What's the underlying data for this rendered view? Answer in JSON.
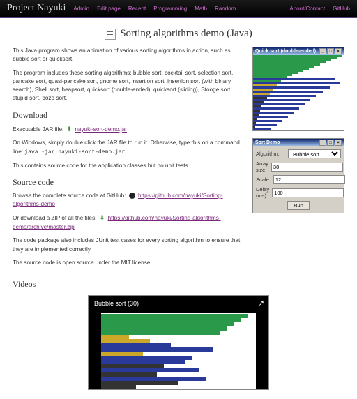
{
  "brand": "Project Nayuki",
  "nav": [
    "Admin",
    "Edit page",
    "",
    "Recent",
    "Programming",
    "Math",
    "Random",
    "",
    "About/Contact",
    "GitHub"
  ],
  "title": "Sorting algorithms demo (Java)",
  "intro1": "This Java program shows an animation of various sorting algorithms in action, such as bubble sort or quicksort.",
  "intro2": "The program includes these sorting algorithms: bubble sort, cocktail sort, selection sort, pancake sort, quasi-pancake sort, gnome sort, insertion sort, insertion sort (with binary search), Shell sort, heapsort, quicksort (double-ended), quicksort (sliding), Stooge sort, stupid sort, bozo sort.",
  "h_download": "Download",
  "dl_label": "Executable JAR file: ",
  "dl_link": "nayuki-sort-demo.jar",
  "dl_win": "On Windows, simply double click the JAR file to run it. Otherwise, type this on a command line: ",
  "dl_cmd": "java -jar nayuki-sort-demo.jar",
  "dl_note": "This contains source code for the application classes but no unit tests.",
  "h_source": "Source code",
  "src_browse": "Browse the complete source code at GitHub: ",
  "src_link1": "https://github.com/nayuki/Sorting-algorithms-demo",
  "src_or": "Or download a ZIP of all the files: ",
  "src_link2": "https://github.com/nayuki/Sorting-algorithms-demo/archive/master.zip",
  "src_junit": "The code package also includes JUnit test cases for every sorting algorithm to ensure that they are implemented correctly.",
  "src_license": "The source code is open source under the MIT license.",
  "h_videos": "Videos",
  "win1_title": "Quick sort (double-ended)",
  "win2_title": "Sort Demo",
  "form": {
    "alg_lbl": "Algorithm:",
    "alg_val": "Bubble sort",
    "arr_lbl": "Array size:",
    "arr_val": "30",
    "scl_lbl": "Scale:",
    "scl_val": "12",
    "dly_lbl": "Delay (ms):",
    "dly_val": "100",
    "run": "Run"
  },
  "video_title": "Bubble sort (30)",
  "chart_data": {
    "type": "bar",
    "title": "Quick sort (double-ended)",
    "values": [
      128,
      120,
      112,
      104,
      96,
      88,
      80,
      72,
      64,
      56,
      48,
      118,
      40,
      124,
      34,
      110,
      28,
      100,
      24,
      90,
      20,
      82,
      16,
      74,
      12,
      66,
      10,
      58,
      8,
      50,
      6,
      42,
      4,
      34,
      3,
      26
    ],
    "colors": [
      "#2a9a4a",
      "#2a9a4a",
      "#2a9a4a",
      "#2a9a4a",
      "#2a9a4a",
      "#2a9a4a",
      "#2a9a4a",
      "#2a9a4a",
      "#2a9a4a",
      "#2a9a4a",
      "#2a9a4a",
      "#2a3a9a",
      "#2a9a4a",
      "#2a3a9a",
      "#cca82a",
      "#2a3a9a",
      "#cca82a",
      "#2a3a9a",
      "#cca82a",
      "#2a3a9a",
      "#333",
      "#2a3a9a",
      "#333",
      "#2a3a9a",
      "#333",
      "#2a3a9a",
      "#333",
      "#2a3a9a",
      "#333",
      "#2a3a9a",
      "#333",
      "#2a3a9a",
      "#333",
      "#2a3a9a",
      "#333",
      "#2a3a9a"
    ]
  },
  "video_data": {
    "type": "bar",
    "title": "Bubble sort (30)",
    "values": [
      210,
      200,
      190,
      180,
      170,
      40,
      70,
      100,
      160,
      60,
      130,
      120,
      90,
      140,
      80,
      150,
      110,
      50
    ],
    "colors": [
      "#2a9a4a",
      "#2a9a4a",
      "#2a9a4a",
      "#2a9a4a",
      "#2a9a4a",
      "#cca82a",
      "#cca82a",
      "#2a3a9a",
      "#2a3a9a",
      "#cca82a",
      "#2a3a9a",
      "#2a3a9a",
      "#333",
      "#2a3a9a",
      "#333",
      "#2a3a9a",
      "#333",
      "#333"
    ]
  }
}
